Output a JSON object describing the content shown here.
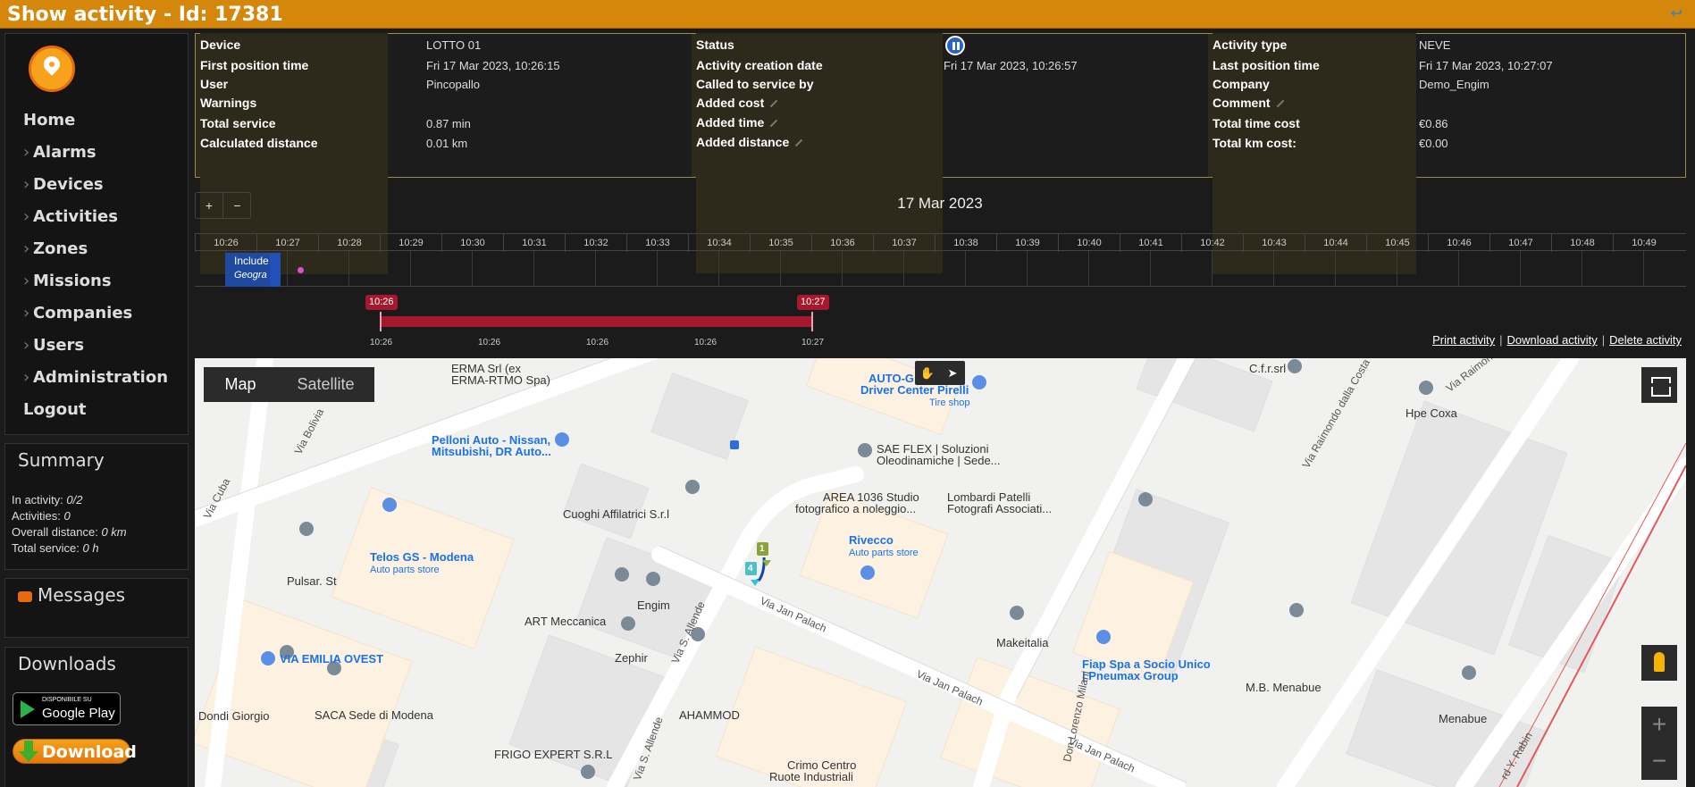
{
  "title": "Show activity - Id: 17381",
  "icons": {
    "back": "back-arrow-icon",
    "logo": "location-pin-logo",
    "status": "pause-circle-icon",
    "messages": "chat-bubble-icon"
  },
  "menu": {
    "home": "Home",
    "alarms": "Alarms",
    "devices": "Devices",
    "activities": "Activities",
    "zones": "Zones",
    "missions": "Missions",
    "companies": "Companies",
    "users": "Users",
    "administration": "Administration",
    "logout": "Logout"
  },
  "summary": {
    "heading": "Summary",
    "in_activity_label": "In activity:",
    "in_activity": "0/2",
    "activities_label": "Activities:",
    "activities": "0",
    "distance_label": "Overall distance:",
    "distance": "0 km",
    "service_label": "Total service:",
    "service": "0 h"
  },
  "messages": {
    "heading": "Messages"
  },
  "downloads": {
    "heading": "Downloads",
    "gplay_small": "DISPONIBILE SU",
    "gplay_big": "Google Play",
    "download": "Download"
  },
  "info": {
    "device_label": "Device",
    "device": "LOTTO 01",
    "first_pos_label": "First position time",
    "first_pos": "Fri 17 Mar 2023, 10:26:15",
    "user_label": "User",
    "user": "Pincopallo",
    "warnings_label": "Warnings",
    "warnings": "",
    "total_service_label": "Total service",
    "total_service": "0.87 min",
    "calc_distance_label": "Calculated distance",
    "calc_distance": "0.01 km",
    "status_label": "Status",
    "creation_label": "Activity creation date",
    "creation": "Fri 17 Mar 2023, 10:26:57",
    "called_label": "Called to service by",
    "called": "",
    "added_cost_label": "Added cost",
    "added_time_label": "Added time",
    "added_distance_label": "Added distance",
    "type_label": "Activity type",
    "type": "NEVE",
    "last_pos_label": "Last position time",
    "last_pos": "Fri 17 Mar 2023, 10:27:07",
    "company_label": "Company",
    "company": "Demo_Engim",
    "comment_label": "Comment",
    "time_cost_label": "Total time cost",
    "time_cost": "€0.86",
    "km_cost_label": "Total km cost:",
    "km_cost": "€0.00"
  },
  "timeline": {
    "zoom_in": "+",
    "zoom_out": "−",
    "date": "17 Mar 2023",
    "ticks": [
      "10:26",
      "10:27",
      "10:28",
      "10:29",
      "10:30",
      "10:31",
      "10:32",
      "10:33",
      "10:34",
      "10:35",
      "10:36",
      "10:37",
      "10:38",
      "10:39",
      "10:40",
      "10:41",
      "10:42",
      "10:43",
      "10:44",
      "10:45",
      "10:46",
      "10:47",
      "10:48",
      "10:49"
    ],
    "block_line1": "Include",
    "block_line2": "Geogra"
  },
  "slider": {
    "start": "10:26",
    "end": "10:27",
    "labels": [
      "10:26",
      "10:26",
      "10:26",
      "10:26",
      "10:27"
    ]
  },
  "actions": {
    "print": "Print activity",
    "download": "Download activity",
    "delete": "Delete activity"
  },
  "map": {
    "tab_map": "Map",
    "tab_satellite": "Satellite",
    "labels": {
      "erma": "ERMA Srl (ex",
      "erma2": "ERMA-RTMO Spa)",
      "autog": "AUTO-G",
      "pirelli": "Driver Center Pirelli",
      "tire": "Tire shop",
      "cfr": "C.f.r.srl",
      "hpe": "Hpe Coxa",
      "pelloni": "Pelloni Auto - Nissan,",
      "pelloni2": "Mitsubishi, DR Auto...",
      "saeflex": "SAE FLEX | Soluzioni",
      "saeflex2": "Oleodinamiche | Sede...",
      "area": "AREA 1036 Studio",
      "area2": "fotografico a noleggio...",
      "lombardi": "Lombardi Patelli",
      "lombardi2": "Fotografi Associati...",
      "cuoghi": "Cuoghi Affilatrici S.r.l",
      "rivecco": "Rivecco",
      "rivecco2": "Auto parts store",
      "telos": "Telos GS - Modena",
      "telos2": "Auto parts store",
      "pulsar": "Pulsar. St",
      "engim": "Engim",
      "art": "ART Meccanica",
      "zephir": "Zephir",
      "ahammod": "AHAMMOD",
      "makeitalia": "Makeitalia",
      "fiap": "Fiap Spa a Socio Unico",
      "fiap2": "| Pneumax Group",
      "mb": "M.B. Menabue",
      "menabue": "Menabue",
      "emilia": "VIA EMILIA OVEST",
      "dondi": "Dondi Giorgio",
      "saca": "SACA Sede di Modena",
      "frigo": "FRIGO EXPERT S.R.L",
      "crimo": "Crimo Centro",
      "crimo2": "Ruote Industriali",
      "via_cuba": "Via Cuba",
      "via_bolivia": "Via Bolivia",
      "via_allende": "Via S. Allende",
      "via_allende2": "Via S. Allende",
      "via_palach1": "Via Jan Palach",
      "via_palach2": "Via Jan Palach",
      "via_palach3": "Via Jan Palach",
      "via_raimondo": "Via Raimondo dalla Costa",
      "via_raimondo2": "Via Raimondo",
      "don_milani": "Don Lorenzo Milani",
      "rabin": "rd Y. Rabin",
      "track_start": "1",
      "track_end": "4"
    }
  }
}
